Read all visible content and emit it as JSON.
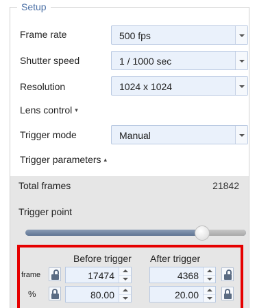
{
  "setup": {
    "legend": "Setup",
    "frame_rate": {
      "label": "Frame rate",
      "value": "500 fps"
    },
    "shutter_speed": {
      "label": "Shutter speed",
      "value": "1 / 1000 sec"
    },
    "resolution": {
      "label": "Resolution",
      "value": "1024 x 1024"
    },
    "lens_control": {
      "label": "Lens control",
      "chevron": "▾"
    },
    "trigger_mode": {
      "label": "Trigger mode",
      "value": "Manual"
    },
    "trigger_parameters": {
      "label": "Trigger parameters",
      "chevron": "▴"
    }
  },
  "trigger": {
    "total_frames_label": "Total frames",
    "total_frames_value": "21842",
    "trigger_point_label": "Trigger point",
    "trigger_point_fraction": 0.8,
    "before_label": "Before trigger",
    "after_label": "After trigger",
    "frame_unit": "frame",
    "percent_unit": "%",
    "before_frames": "17474",
    "after_frames": "4368",
    "before_percent": "80.00",
    "after_percent": "20.00"
  },
  "colors": {
    "highlight_border": "#e60000",
    "field_bg": "#eaf1fb",
    "legend": "#4a6fa5"
  },
  "icons": [
    "dropdown-arrow-icon",
    "lock-open-icon",
    "lock-closed-icon",
    "spin-up-icon",
    "spin-down-icon"
  ]
}
